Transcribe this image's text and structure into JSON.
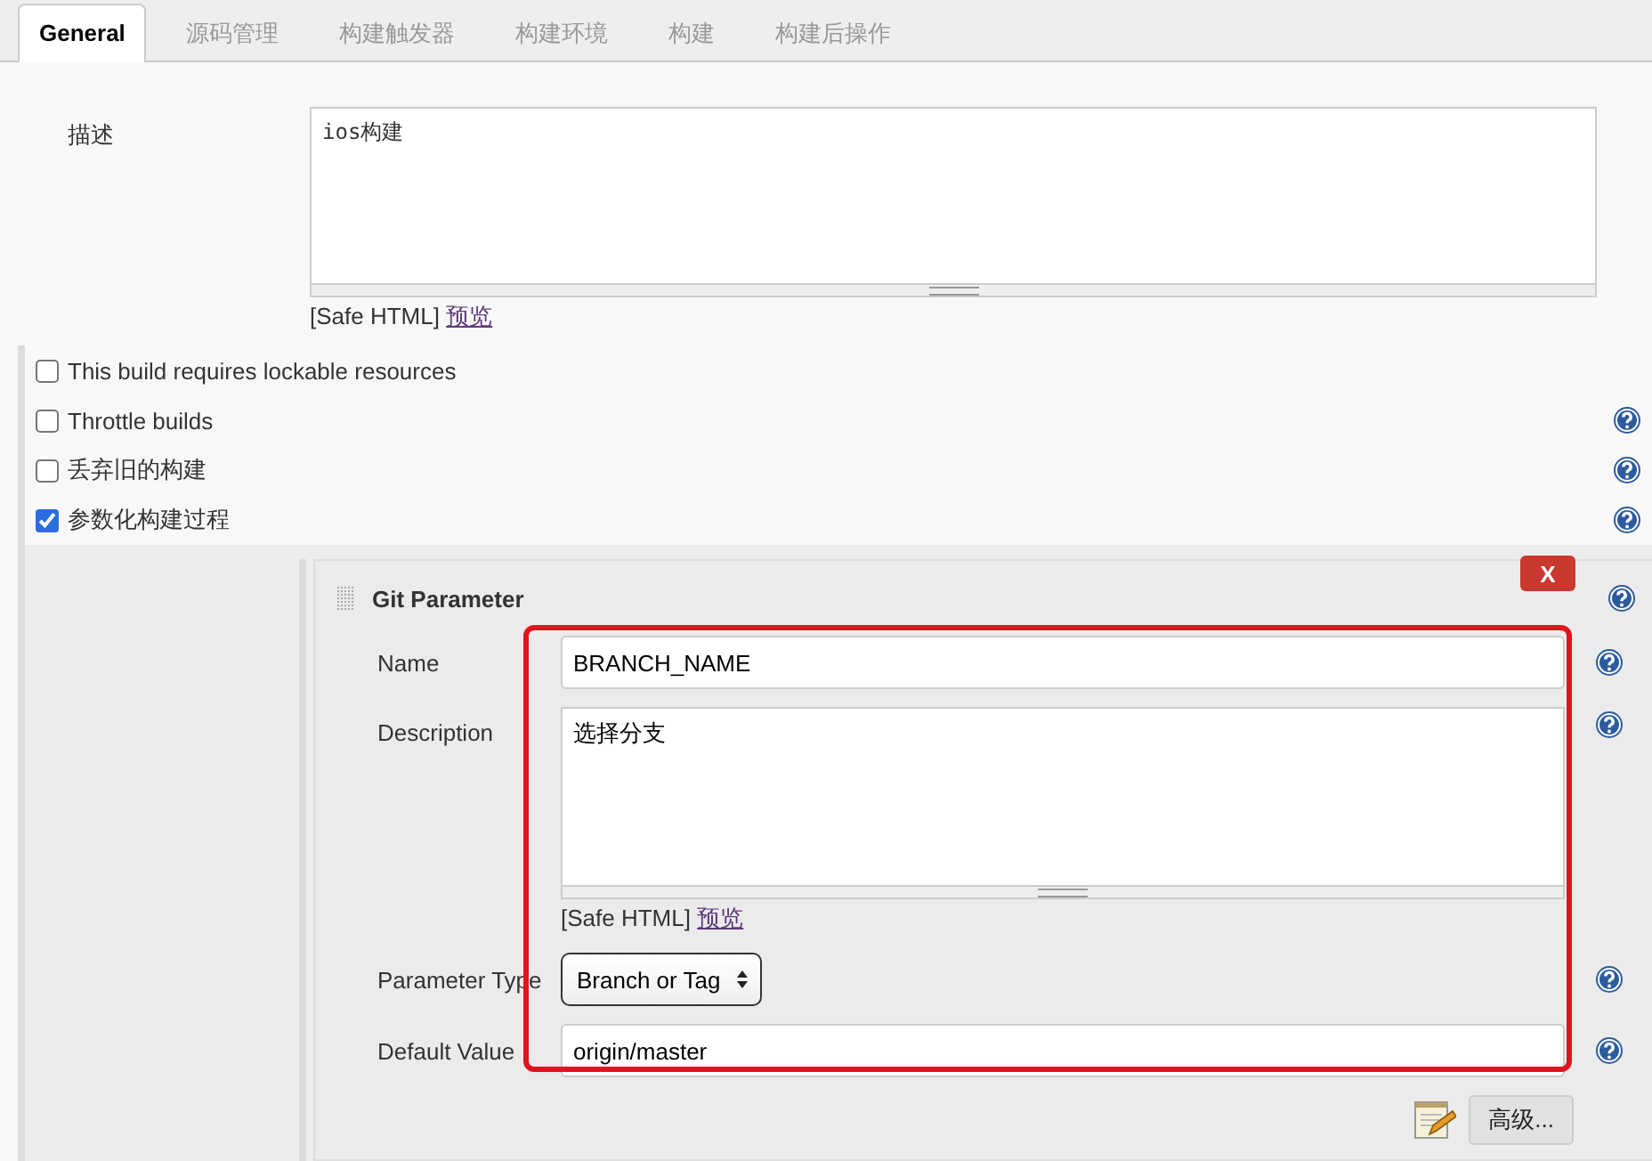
{
  "tabs": [
    {
      "label": "General",
      "selected": true
    },
    {
      "label": "源码管理",
      "selected": false
    },
    {
      "label": "构建触发器",
      "selected": false
    },
    {
      "label": "构建环境",
      "selected": false
    },
    {
      "label": "构建",
      "selected": false
    },
    {
      "label": "构建后操作",
      "selected": false
    }
  ],
  "description": {
    "label": "描述",
    "value": "ios构建",
    "format": "[Safe HTML]",
    "preview_link": "预览"
  },
  "options": [
    {
      "label": "This build requires lockable resources",
      "checked": false,
      "help": false
    },
    {
      "label": "Throttle builds",
      "checked": false,
      "help": true
    },
    {
      "label": "丢弃旧的构建",
      "checked": false,
      "help": true
    },
    {
      "label": "参数化构建过程",
      "checked": true,
      "help": true
    }
  ],
  "parameter": {
    "title": "Git Parameter",
    "delete_button": "X",
    "help": true,
    "fields": [
      {
        "kind": "text",
        "label": "Name",
        "value": "BRANCH_NAME",
        "help": true
      },
      {
        "kind": "textarea",
        "label": "Description",
        "value": "选择分支",
        "format": "[Safe HTML]",
        "preview_link": "预览",
        "help": true
      },
      {
        "kind": "select",
        "label": "Parameter Type",
        "value": "Branch or Tag",
        "help": true
      },
      {
        "kind": "text",
        "label": "Default Value",
        "value": "origin/master",
        "help": true
      }
    ],
    "advanced_button": "高级..."
  }
}
